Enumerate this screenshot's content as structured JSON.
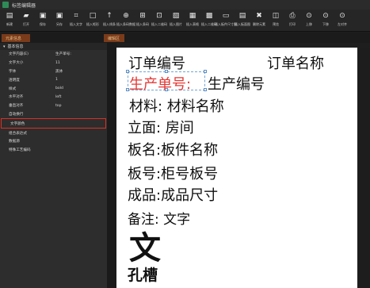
{
  "window": {
    "title": "标签编辑器"
  },
  "toolbar": {
    "items": [
      {
        "label": "新建",
        "icon": "new-file-icon",
        "glyph": "▤"
      },
      {
        "label": "打开",
        "icon": "folder-open-icon",
        "glyph": "▰"
      },
      {
        "label": "保存",
        "icon": "save-icon",
        "glyph": "▣"
      },
      {
        "label": "另存",
        "icon": "save-as-icon",
        "glyph": "▣"
      },
      {
        "label": "插入文字",
        "icon": "insert-text-icon",
        "glyph": "⌗"
      },
      {
        "label": "插入矩形",
        "icon": "insert-rectangle-icon",
        "glyph": "□"
      },
      {
        "label": "插入线条",
        "icon": "insert-line-icon",
        "glyph": "↑"
      },
      {
        "label": "插入条码数据",
        "icon": "insert-barcode-data-icon",
        "glyph": "⊕"
      },
      {
        "label": "插入条码",
        "icon": "insert-barcode-icon",
        "glyph": "⊞"
      },
      {
        "label": "插入二维码",
        "icon": "insert-qrcode-icon",
        "glyph": "⊡"
      },
      {
        "label": "插入图片",
        "icon": "insert-image-icon",
        "glyph": "▧"
      },
      {
        "label": "插入表格",
        "icon": "insert-table-icon",
        "glyph": "▦"
      },
      {
        "label": "插入二维码",
        "icon": "insert-qrcode2-icon",
        "glyph": "▩"
      },
      {
        "label": "插入板件尺寸图",
        "icon": "insert-panel-drawing-icon",
        "glyph": "▭"
      },
      {
        "label": "插入板面图",
        "icon": "insert-panel-face-icon",
        "glyph": "▤"
      },
      {
        "label": "删除元素",
        "icon": "delete-icon",
        "glyph": "✖"
      },
      {
        "label": "预览",
        "icon": "preview-icon",
        "glyph": "◫"
      },
      {
        "label": "打印",
        "icon": "print-icon",
        "glyph": "⎙"
      },
      {
        "label": "上移",
        "icon": "move-up-icon",
        "glyph": "⊙"
      },
      {
        "label": "下移",
        "icon": "move-down-icon",
        "glyph": "⊙"
      },
      {
        "label": "左对齐",
        "icon": "align-left-icon",
        "glyph": "⊙"
      }
    ]
  },
  "tabs": {
    "properties": "元素信息",
    "canvas": "编辑区"
  },
  "props": {
    "section": "基本信息",
    "rows": [
      {
        "key": "文字内容(E)",
        "value": "生产单号:"
      },
      {
        "key": "文字大小",
        "value": "11"
      },
      {
        "key": "字体",
        "value": "黑体"
      },
      {
        "key": "透明度",
        "value": "1"
      },
      {
        "key": "样式",
        "value": "bold"
      },
      {
        "key": "水平对齐",
        "value": "left"
      },
      {
        "key": "垂直对齐",
        "value": "top"
      },
      {
        "key": "自动换行",
        "value": ""
      },
      {
        "key": "文字颜色",
        "value": ""
      },
      {
        "key": "组合表达式",
        "value": ""
      },
      {
        "key": "数据源",
        "value": ""
      },
      {
        "key": "特殊工艺编码",
        "value": ""
      }
    ]
  },
  "canvas": {
    "order_no": "订单编号",
    "order_name": "订单名称",
    "prod_label": "生产单号:",
    "prod_value": "生产编号",
    "material": "材料: 材料名称",
    "elevation": "立面: 房间",
    "panel_name": "板名:板件名称",
    "panel_no": "板号:柜号板号",
    "finished": "成品:成品尺寸",
    "remark": "备注: 文字",
    "big_char": "文",
    "slot": "孔槽"
  },
  "colors": {
    "selected_text": "#e53935",
    "selection_outline": "#d93025",
    "tab_bg": "#7a3b1a"
  }
}
